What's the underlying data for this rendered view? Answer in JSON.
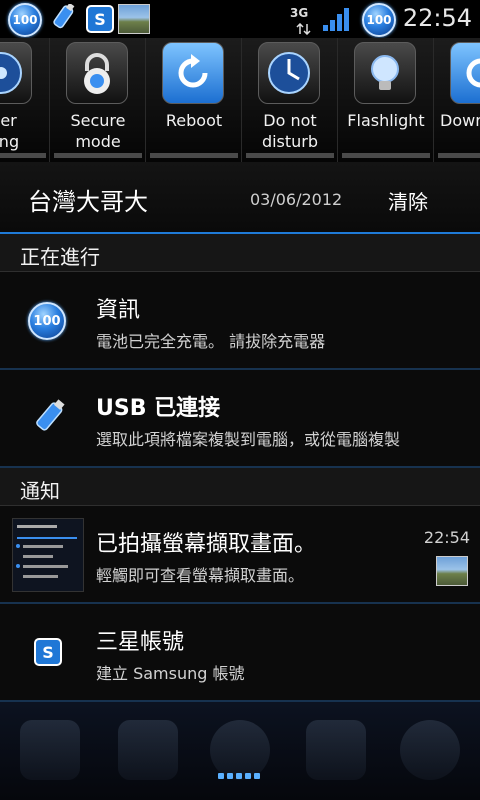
{
  "status_bar": {
    "battery_badge_left": "100",
    "battery_badge_right": "100",
    "network": "3G",
    "time": "22:54",
    "icons": [
      "battery-100-icon",
      "usb-icon",
      "samsung-account-icon",
      "screenshot-thumbnail-icon"
    ]
  },
  "toggles": [
    {
      "label": "wer\nving",
      "icon": "power-saving-icon"
    },
    {
      "label": "Secure\nmode",
      "icon": "lock-icon"
    },
    {
      "label": "Reboot",
      "icon": "reboot-icon"
    },
    {
      "label": "Do not\ndisturb",
      "icon": "do-not-disturb-icon"
    },
    {
      "label": "Flashlight",
      "icon": "flashlight-icon"
    },
    {
      "label": "Dowr",
      "icon": "download-icon"
    }
  ],
  "header": {
    "carrier": "台灣大哥大",
    "date": "03/06/2012",
    "clear_label": "清除"
  },
  "sections": {
    "ongoing": "正在進行",
    "notifications": "通知"
  },
  "ongoing_items": [
    {
      "title": "資訊",
      "subtitle": "電池已完全充電。 請拔除充電器",
      "icon": "battery-100-icon",
      "badge": "100"
    },
    {
      "title": "USB 已連接",
      "subtitle": "選取此項將檔案複製到電腦，或從電腦複製",
      "icon": "usb-icon"
    }
  ],
  "notification_items": [
    {
      "title": "已拍攝螢幕擷取畫面。",
      "subtitle": "輕觸即可查看螢幕擷取畫面。",
      "time": "22:54",
      "icon": "screenshot-thumbnail-icon"
    },
    {
      "title": "三星帳號",
      "subtitle": "建立 Samsung 帳號",
      "icon": "samsung-account-icon"
    }
  ],
  "colors": {
    "accent": "#1f7bd8",
    "background": "#000000"
  }
}
